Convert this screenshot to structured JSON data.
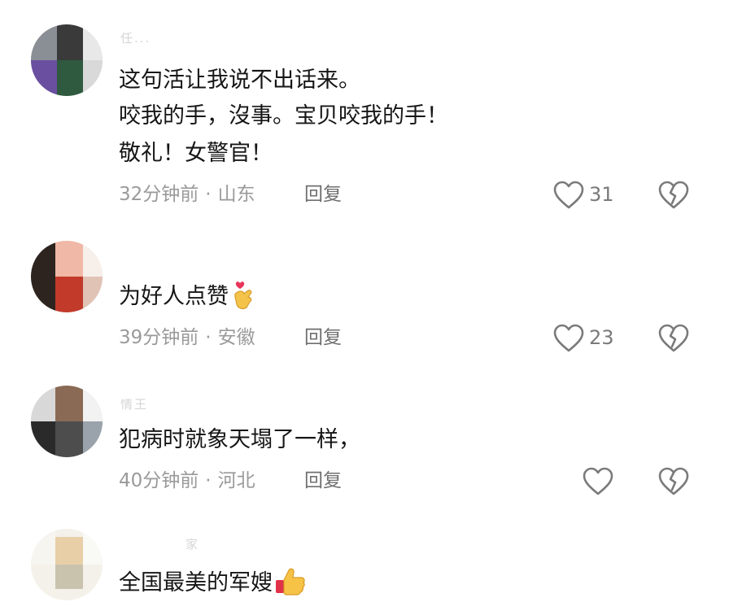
{
  "comments": [
    {
      "username": "任...",
      "lines": [
        "这句活让我说不出话来。",
        "咬我的手，沒事。宝贝咬我的手！",
        "敬礼！女警官！"
      ],
      "time": "32分钟前",
      "location": "山东",
      "reply_label": "回复",
      "like_count": "31"
    },
    {
      "username": "",
      "lines": [
        "为好人点赞"
      ],
      "emoji": "finger-heart-emoji",
      "time": "39分钟前",
      "location": "安徽",
      "reply_label": "回复",
      "like_count": "23"
    },
    {
      "username": "情王",
      "lines": [
        "犯病时就象天塌了一样，"
      ],
      "time": "40分钟前",
      "location": "河北",
      "reply_label": "回复",
      "like_count": ""
    },
    {
      "username": "家",
      "lines": [
        "全国最美的军嫂"
      ],
      "emoji": "thumbs-up-emoji"
    }
  ],
  "colors": {
    "text": "#161616",
    "meta": "#9a9a9a",
    "reply": "#6f6f6f",
    "icon": "#7a7a7a"
  }
}
